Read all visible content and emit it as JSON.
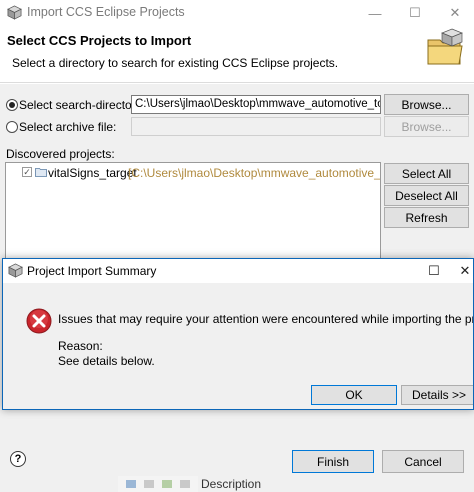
{
  "window": {
    "title": "Import CCS Eclipse Projects",
    "minimize_glyph": "—",
    "maximize_glyph": "☐",
    "close_glyph": "✕"
  },
  "header": {
    "title": "Select CCS Projects to Import",
    "description": "Select a directory to search for existing CCS Eclipse projects."
  },
  "source": {
    "search_dir_label": "Select search-directory:",
    "search_dir_value": "C:\\Users\\jlmao\\Desktop\\mmwave_automotive_toolb",
    "archive_label": "Select archive file:",
    "archive_value": "",
    "browse_label": "Browse...",
    "browse_archive_label": "Browse..."
  },
  "projects": {
    "label": "Discovered projects:",
    "items": [
      {
        "name": "vitalSigns_target",
        "path": "[C:\\Users\\jlmao\\Desktop\\mmwave_automotive_toolbo"
      }
    ],
    "select_all": "Select All",
    "deselect_all": "Deselect All",
    "refresh": "Refresh"
  },
  "dialog": {
    "title": "Project Import Summary",
    "message": "Issues that may require your attention were encountered while importing the project(s).",
    "reason_label": "Reason:",
    "reason_text": "See details below.",
    "ok_label": "OK",
    "details_label": "Details >>",
    "maximize_glyph": "☐",
    "close_glyph": "✕"
  },
  "footer": {
    "finish_label": "Finish",
    "cancel_label": "Cancel",
    "help_glyph": "?",
    "background_text": "Description"
  },
  "colors": {
    "accent": "#0078d7",
    "error": "#c9242b",
    "path_text": "#b08a3e"
  }
}
